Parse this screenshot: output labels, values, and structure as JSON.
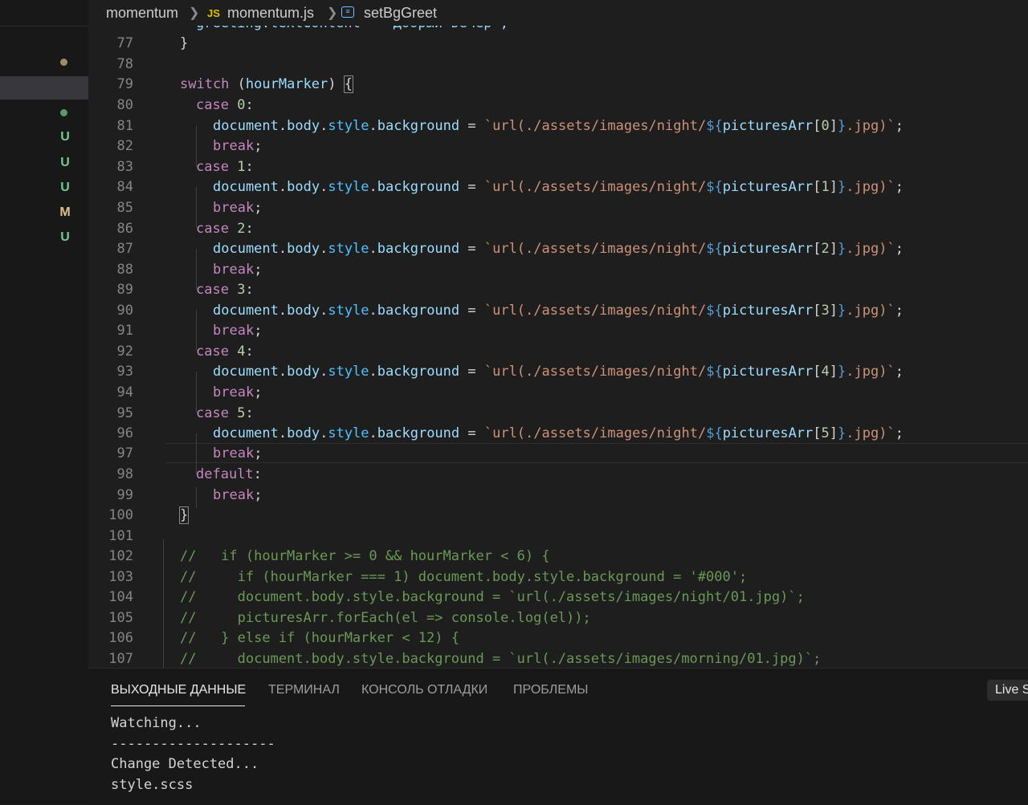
{
  "breadcrumb": {
    "folder": "momentum",
    "js_badge": "JS",
    "file": "momentum.js",
    "symbol": "setBgGreet"
  },
  "explorer": {
    "git_status": [
      "U",
      "U",
      "U",
      "M",
      "U"
    ],
    "colors": {
      "untracked": "#73c991",
      "modified": "#e2c08d",
      "dot_modified": "#a08a6c",
      "dot_untracked": "#5a9a6a"
    }
  },
  "editor": {
    "partial_line_text": "greeting.textContent = 'Добрый вечер';",
    "lines": {
      "77": "}",
      "78": "",
      "79": "switch (hourMarker) {",
      "80": "case 0:",
      "81": "document.body.style.background = `url(./assets/images/night/${picturesArr[0]}.jpg)`;",
      "82": "break;",
      "83": "case 1:",
      "84": "document.body.style.background = `url(./assets/images/night/${picturesArr[1]}.jpg)`;",
      "85": "break;",
      "86": "case 2:",
      "87": "document.body.style.background = `url(./assets/images/night/${picturesArr[2]}.jpg)`;",
      "88": "break;",
      "89": "case 3:",
      "90": "document.body.style.background = `url(./assets/images/night/${picturesArr[3]}.jpg)`;",
      "91": "break;",
      "92": "case 4:",
      "93": "document.body.style.background = `url(./assets/images/night/${picturesArr[4]}.jpg)`;",
      "94": "break;",
      "95": "case 5:",
      "96": "document.body.style.background = `url(./assets/images/night/${picturesArr[5]}.jpg)`;",
      "97": "break;",
      "98": "default:",
      "99": "break;",
      "100": "}",
      "101": "",
      "102": "//   if (hourMarker >= 0 && hourMarker < 6) {",
      "103": "//     if (hourMarker === 1) document.body.style.background = '#000';",
      "104": "//     document.body.style.background = `url(./assets/images/night/01.jpg)`;",
      "105": "//     picturesArr.forEach(el => console.log(el));",
      "106": "//   } else if (hourMarker < 12) {",
      "107": "//     document.body.style.background = `url(./assets/images/morning/01.jpg)`;"
    }
  },
  "panel": {
    "tabs": [
      "ВЫХОДНЫЕ ДАННЫЕ",
      "ТЕРМИНАЛ",
      "КОНСОЛЬ ОТЛАДКИ",
      "ПРОБЛЕМЫ"
    ],
    "live_button": "Live S",
    "output": [
      "Watching...",
      "--------------------",
      "Change Detected...",
      "style.scss"
    ]
  }
}
